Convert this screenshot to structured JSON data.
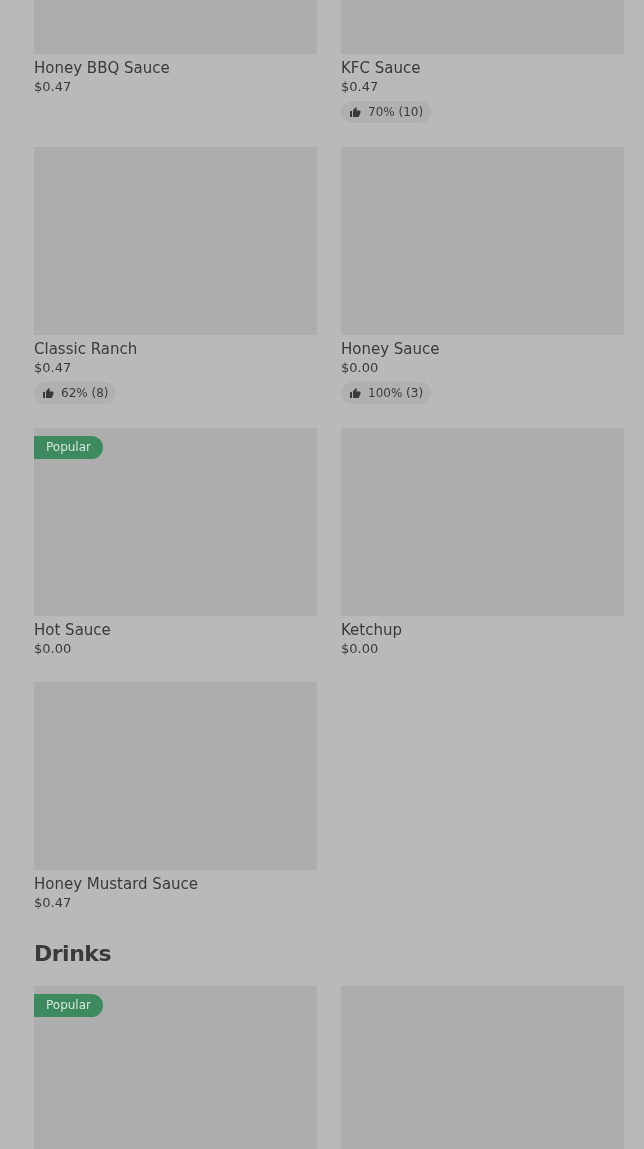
{
  "sections": [
    {
      "items": [
        {
          "kind": "product",
          "name": "Honey BBQ Sauce",
          "price": "$0.47"
        },
        {
          "kind": "product",
          "name": "KFC Sauce",
          "price": "$0.47",
          "rating": "70% (10)"
        },
        {
          "kind": "product",
          "name": "Classic Ranch",
          "price": "$0.47",
          "rating": "62% (8)"
        },
        {
          "kind": "product",
          "name": "Honey Sauce",
          "price": "$0.00",
          "rating": "100% (3)"
        },
        {
          "kind": "product",
          "name": "Hot Sauce",
          "price": "$0.00",
          "badge": "Popular"
        },
        {
          "kind": "product",
          "name": "Ketchup",
          "price": "$0.00"
        },
        {
          "kind": "product",
          "name": "Honey Mustard Sauce",
          "price": "$0.47"
        }
      ]
    },
    {
      "title": "Drinks",
      "items": [
        {
          "kind": "product",
          "badge": "Popular"
        },
        {
          "kind": "product"
        }
      ]
    }
  ]
}
